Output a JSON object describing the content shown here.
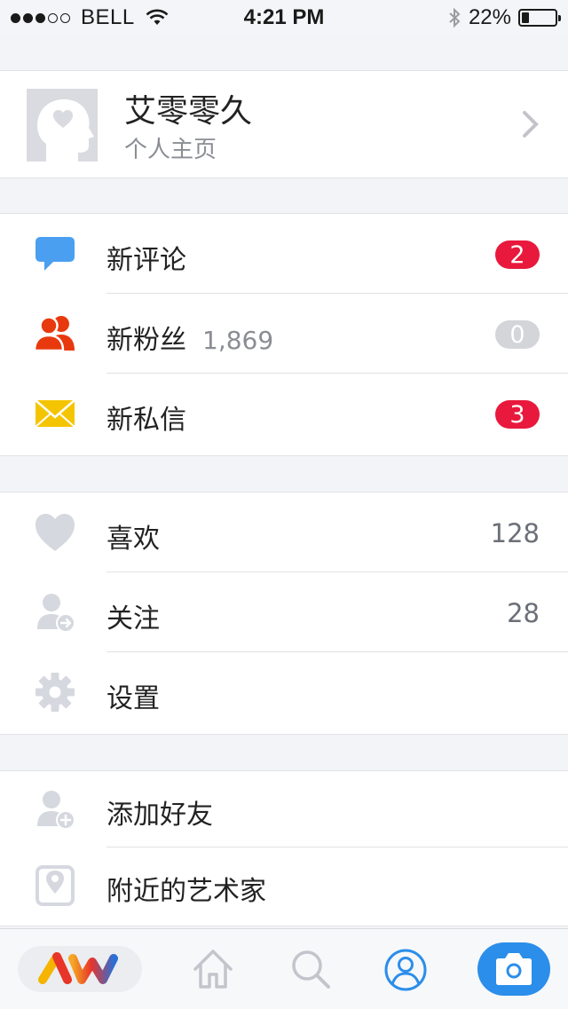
{
  "status_bar": {
    "carrier": "BELL",
    "time": "4:21 PM",
    "battery_text": "22%",
    "battery_level": 0.22,
    "signal_bars": 3,
    "signal_total": 5
  },
  "profile": {
    "name": "艾零零久",
    "subtitle": "个人主页",
    "avatar_icon": "head-heart-icon",
    "chevron_icon": "chevron-right-icon"
  },
  "notifications": [
    {
      "label": "新评论",
      "icon": "chat-bubble-icon",
      "icon_color": "#4a9ff0",
      "badge": "2",
      "badge_color": "#e8193c"
    },
    {
      "label": "新粉丝",
      "extra": "1,869",
      "icon": "users-icon",
      "icon_color": "#e8390e",
      "badge": "0",
      "badge_color": "#d3d5d9"
    },
    {
      "label": "新私信",
      "icon": "envelope-icon",
      "icon_color": "#f5c400",
      "badge": "3",
      "badge_color": "#e8193c"
    }
  ],
  "account": [
    {
      "label": "喜欢",
      "icon": "heart-icon",
      "value": "128"
    },
    {
      "label": "关注",
      "icon": "user-follow-icon",
      "value": "28"
    },
    {
      "label": "设置",
      "icon": "gear-icon",
      "value": ""
    }
  ],
  "discover": [
    {
      "label": "添加好友",
      "icon": "user-add-icon"
    },
    {
      "label": "附近的艺术家",
      "icon": "map-pin-icon"
    }
  ],
  "tab_bar": {
    "tabs": [
      "logo-aw-icon",
      "home-icon",
      "search-icon",
      "profile-icon",
      "camera-icon"
    ],
    "active": "profile-icon",
    "accent": "#2b8eea"
  }
}
